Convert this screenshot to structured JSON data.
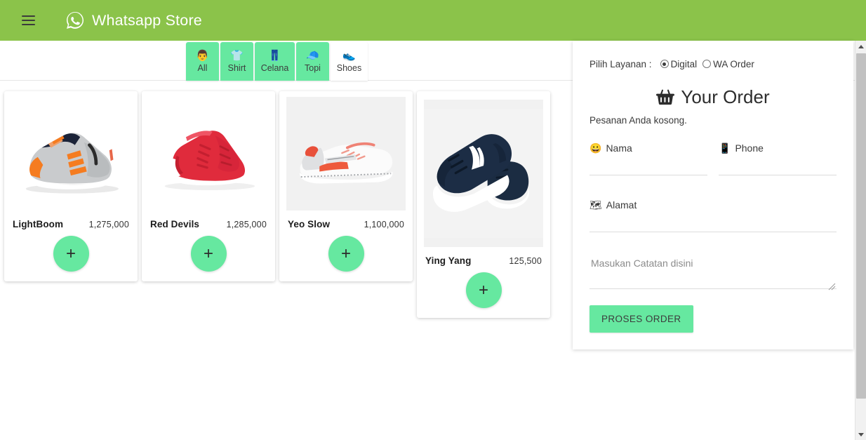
{
  "header": {
    "menu_icon": "hamburger-menu-icon",
    "logo_icon": "whatsapp-logo-icon",
    "title": "Whatsapp Store",
    "background_color": "#8bc34a"
  },
  "tabs": [
    {
      "label": "All",
      "icon": "👨",
      "icon_name": "person-icon",
      "active": false
    },
    {
      "label": "Shirt",
      "icon": "👕",
      "icon_name": "tshirt-icon",
      "active": false
    },
    {
      "label": "Celana",
      "icon": "👖",
      "icon_name": "jeans-icon",
      "active": false
    },
    {
      "label": "Topi",
      "icon": "🧢",
      "icon_name": "cap-icon",
      "active": false
    },
    {
      "label": "Shoes",
      "icon": "👟",
      "icon_name": "shoe-icon",
      "active": true
    }
  ],
  "products": [
    {
      "name": "LightBoom",
      "price": "1,275,000",
      "add_label": "+",
      "image_name": "gray-orange-sneaker-image"
    },
    {
      "name": "Red Devils",
      "price": "1,285,000",
      "add_label": "+",
      "image_name": "red-sneaker-image"
    },
    {
      "name": "Yeo Slow",
      "price": "1,100,000",
      "add_label": "+",
      "image_name": "white-red-sneaker-image"
    },
    {
      "name": "Ying Yang",
      "price": "125,500",
      "add_label": "+",
      "image_name": "navy-sneaker-image"
    }
  ],
  "order_panel": {
    "service_label": "Pilih Layanan :",
    "service_options": [
      {
        "label": "Digital",
        "selected": true
      },
      {
        "label": "WA Order",
        "selected": false
      }
    ],
    "title": "Your Order",
    "title_icon": "shopping-basket-icon",
    "empty_message": "Pesanan Anda kosong.",
    "fields": {
      "nama": {
        "label": "Nama",
        "icon": "😀",
        "icon_name": "smiley-face-icon",
        "value": "",
        "placeholder": ""
      },
      "phone": {
        "label": "Phone",
        "icon": "📱",
        "icon_name": "mobile-phone-icon",
        "value": "",
        "placeholder": ""
      },
      "alamat": {
        "label": "Alamat",
        "icon": "🗺",
        "icon_name": "map-location-icon",
        "value": "",
        "placeholder": ""
      },
      "catatan": {
        "value": "",
        "placeholder": "Masukan Catatan disini"
      }
    },
    "submit_label": "PROSES ORDER"
  },
  "scrollbar": {
    "up_icon": "scroll-up-arrow-icon",
    "down_icon": "scroll-down-arrow-icon"
  },
  "colors": {
    "header_green": "#8bc34a",
    "accent_mint": "#66e8a0",
    "panel_bg": "#ffffff"
  }
}
